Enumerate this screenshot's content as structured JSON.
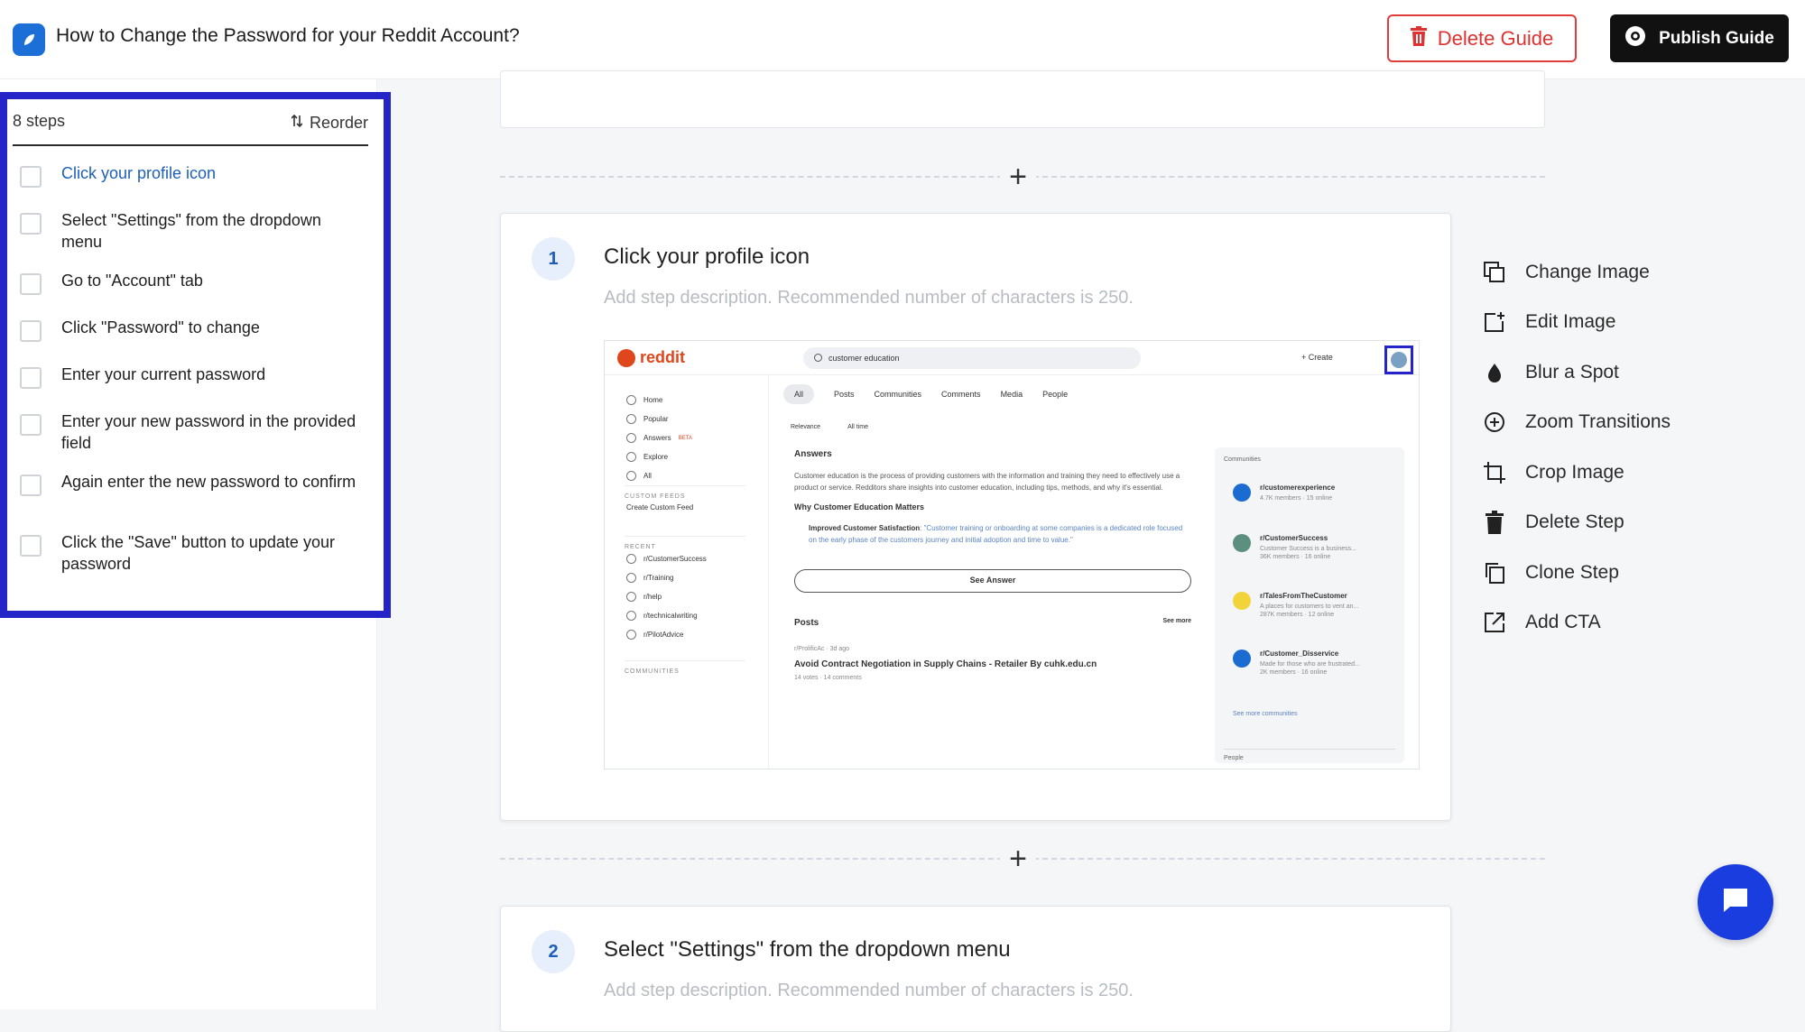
{
  "header": {
    "title": "How to Change the Password for your Reddit Account?",
    "delete_label": "Delete Guide",
    "publish_label": "Publish Guide"
  },
  "sidebar": {
    "steps_count": "8 steps",
    "reorder_label": "Reorder",
    "steps": [
      {
        "label": "Click your profile icon"
      },
      {
        "label": "Select \"Settings\" from the dropdown menu"
      },
      {
        "label": "Go to \"Account\" tab"
      },
      {
        "label": "Click \"Password\" to change"
      },
      {
        "label": "Enter your current password"
      },
      {
        "label": "Enter your new password in the provided field"
      },
      {
        "label": "Again enter the new password to confirm"
      },
      {
        "label": "Click the \"Save\" button to update your password"
      }
    ]
  },
  "cards": [
    {
      "number": "1",
      "title": "Click your profile icon",
      "description_placeholder": "Add step description. Recommended number of characters is 250."
    },
    {
      "number": "2",
      "title": "Select \"Settings\" from the dropdown menu",
      "description_placeholder": "Add step description. Recommended number of characters is 250."
    }
  ],
  "add_step_symbol": "+",
  "tools": [
    {
      "label": "Change Image",
      "icon": "change-image-icon"
    },
    {
      "label": "Edit Image",
      "icon": "edit-image-icon"
    },
    {
      "label": "Blur a Spot",
      "icon": "blur-icon"
    },
    {
      "label": "Zoom Transitions",
      "icon": "zoom-icon"
    },
    {
      "label": "Crop Image",
      "icon": "crop-icon"
    },
    {
      "label": "Delete Step",
      "icon": "trash-icon"
    },
    {
      "label": "Clone Step",
      "icon": "clone-icon"
    },
    {
      "label": "Add CTA",
      "icon": "external-link-icon"
    }
  ],
  "screenshot": {
    "logo": "reddit",
    "search_value": "customer education",
    "create_label": "Create",
    "nav": [
      "Home",
      "Popular",
      "Answers",
      "Explore",
      "All"
    ],
    "answers_badge": "BETA",
    "sections": {
      "custom_feeds": "CUSTOM FEEDS",
      "create_feed": "Create Custom Feed",
      "recent": "RECENT",
      "communities": "COMMUNITIES"
    },
    "recent": [
      "r/CustomerSuccess",
      "r/Training",
      "r/help",
      "r/technicalwriting",
      "r/PilotAdvice"
    ],
    "tabs": [
      "All",
      "Posts",
      "Communities",
      "Comments",
      "Media",
      "People"
    ],
    "filters": [
      "Relevance",
      "All time"
    ],
    "answers_title": "Answers",
    "answers_text": "Customer education is the process of providing customers with the information and training they need to effectively use a product or service. Redditors share insights into customer education, including tips, methods, and why it's essential.",
    "answers_sub": "Why Customer Education Matters",
    "answers_bullet_bold": "Improved Customer Satisfaction",
    "answers_bullet": "\"Customer training or onboarding at some companies is a dedicated role focused on the early phase of the customers journey and initial adoption and time to value.\"",
    "see_answer": "See Answer",
    "posts_title": "Posts",
    "see_more": "See more",
    "post_sub": "r/ProlificAc · 3d ago",
    "post_title": "Avoid Contract Negotiation in Supply Chains - Retailer By cuhk.edu.cn",
    "post_meta": "14 votes · 14 comments",
    "communities_title": "Communities",
    "communities": [
      {
        "name": "r/customerexperience",
        "meta": "4.7K members · 15 online"
      },
      {
        "name": "r/CustomerSuccess",
        "desc": "Customer Success is a business...",
        "meta": "36K members · 16 online"
      },
      {
        "name": "r/TalesFromTheCustomer",
        "desc": "A places for customers to vent an...",
        "meta": "287K members · 12 online"
      },
      {
        "name": "r/Customer_Disservice",
        "desc": "Made for those who are frustrated...",
        "meta": "2K members · 16 online"
      }
    ],
    "see_more_comm": "See more communities",
    "people": "People"
  },
  "colors": {
    "accent": "#1d5fb8",
    "highlight": "#2424c8",
    "danger": "#e03131",
    "reddit": "#e0461b"
  }
}
